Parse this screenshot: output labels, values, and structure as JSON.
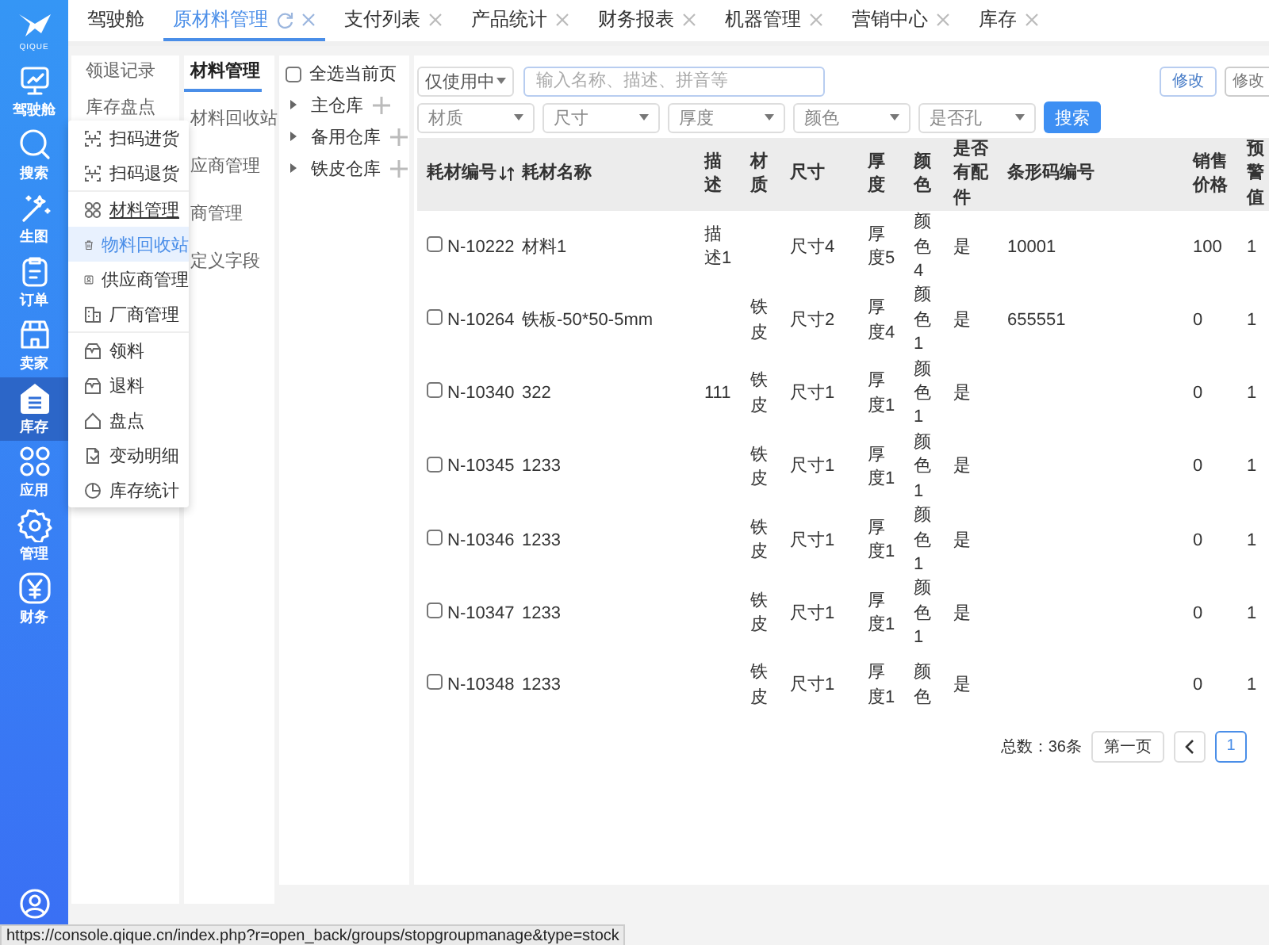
{
  "logo": {
    "text": "QIQUE"
  },
  "nav": [
    {
      "label": "驾驶舱",
      "selected": false
    },
    {
      "label": "搜索",
      "selected": false
    },
    {
      "label": "生图",
      "selected": false
    },
    {
      "label": "订单",
      "selected": false
    },
    {
      "label": "卖家",
      "selected": false
    },
    {
      "label": "库存",
      "selected": true
    },
    {
      "label": "应用",
      "selected": false
    },
    {
      "label": "管理",
      "selected": false
    },
    {
      "label": "财务",
      "selected": false
    }
  ],
  "tabs": [
    {
      "label": "驾驶舱",
      "selected": false,
      "closable": false,
      "refreshable": false
    },
    {
      "label": "原材料管理",
      "selected": true,
      "closable": true,
      "refreshable": true
    },
    {
      "label": "支付列表",
      "selected": false,
      "closable": true,
      "refreshable": false
    },
    {
      "label": "产品统计",
      "selected": false,
      "closable": true,
      "refreshable": false
    },
    {
      "label": "财务报表",
      "selected": false,
      "closable": true,
      "refreshable": false
    },
    {
      "label": "机器管理",
      "selected": false,
      "closable": true,
      "refreshable": false
    },
    {
      "label": "营销中心",
      "selected": false,
      "closable": true,
      "refreshable": false
    },
    {
      "label": "库存",
      "selected": false,
      "closable": true,
      "refreshable": false
    }
  ],
  "subnav_1": {
    "items": [
      {
        "label": "领退记录",
        "selected": false
      },
      {
        "label": "库存盘点",
        "selected": false
      }
    ]
  },
  "subnav_2": {
    "items": [
      {
        "label": "材料管理",
        "selected": true
      },
      {
        "label": "材料回收站",
        "selected": false
      },
      {
        "label": "应商管理",
        "selected": false
      },
      {
        "label": "商管理",
        "selected": false
      },
      {
        "label": "定义字段",
        "selected": false
      }
    ]
  },
  "dropdown": {
    "groups": [
      [
        {
          "label": "扫码进货",
          "selected": false,
          "hovered": false
        },
        {
          "label": "扫码退货",
          "selected": false,
          "hovered": false
        }
      ],
      [
        {
          "label": "材料管理",
          "selected": false,
          "hovered": true
        },
        {
          "label": "物料回收站",
          "selected": true,
          "hovered": false
        },
        {
          "label": "供应商管理",
          "selected": false,
          "hovered": false
        },
        {
          "label": "厂商管理",
          "selected": false,
          "hovered": false
        }
      ],
      [
        {
          "label": "领料",
          "selected": false,
          "hovered": false
        },
        {
          "label": "退料",
          "selected": false,
          "hovered": false
        },
        {
          "label": "盘点",
          "selected": false,
          "hovered": false
        },
        {
          "label": "变动明细",
          "selected": false,
          "hovered": false
        },
        {
          "label": "库存统计",
          "selected": false,
          "hovered": false
        }
      ]
    ]
  },
  "tree": {
    "select_all": {
      "label": "全选当前页",
      "checked": false
    },
    "nodes": [
      {
        "label": "主仓库",
        "expanded": false
      },
      {
        "label": "备用仓库",
        "expanded": false
      },
      {
        "label": "铁皮仓库",
        "expanded": false
      }
    ]
  },
  "filters": {
    "status_select": "仅使用中",
    "search": {
      "placeholder": "输入名称、描述、拼音等"
    },
    "selects": [
      "材质",
      "尺寸",
      "厚度",
      "颜色",
      "是否孔"
    ],
    "search_button": "搜索",
    "buttons": [
      "修改",
      "修改"
    ]
  },
  "table": {
    "columns": [
      "耗材编号",
      "耗材名称",
      "描述",
      "材质",
      "尺寸",
      "厚度",
      "颜色",
      "是否有配件",
      "条形码编号",
      "销售价格",
      "预警值"
    ],
    "rows": [
      {
        "checked": false,
        "cells": [
          "N-10222",
          "材料1",
          "描述1",
          "",
          "尺寸4",
          "厚度5",
          "颜色4",
          "是",
          "10001",
          "100",
          "1"
        ]
      },
      {
        "checked": false,
        "cells": [
          "N-10264",
          "铁板-50*50-5mm",
          "",
          "铁皮",
          "尺寸2",
          "厚度4",
          "颜色1",
          "是",
          "655551",
          "0",
          "1"
        ]
      },
      {
        "checked": false,
        "cells": [
          "N-10340",
          "322",
          "111",
          "铁皮",
          "尺寸1",
          "厚度1",
          "颜色1",
          "是",
          "",
          "0",
          "1"
        ]
      },
      {
        "checked": false,
        "cells": [
          "N-10345",
          "1233",
          "",
          "铁皮",
          "尺寸1",
          "厚度1",
          "颜色1",
          "是",
          "",
          "0",
          "1"
        ]
      },
      {
        "checked": false,
        "cells": [
          "N-10346",
          "1233",
          "",
          "铁皮",
          "尺寸1",
          "厚度1",
          "颜色1",
          "是",
          "",
          "0",
          "1"
        ]
      },
      {
        "checked": false,
        "cells": [
          "N-10347",
          "1233",
          "",
          "铁皮",
          "尺寸1",
          "厚度1",
          "颜色1",
          "是",
          "",
          "0",
          "1"
        ]
      },
      {
        "checked": false,
        "cells": [
          "N-10348",
          "1233",
          "",
          "铁皮",
          "尺寸1",
          "厚度1",
          "颜色",
          "是",
          "",
          "0",
          "1"
        ]
      }
    ]
  },
  "pagination": {
    "total": "总数：36条",
    "first": "第一页",
    "pages": [
      {
        "label": "1",
        "selected": true
      }
    ]
  },
  "status_bar": {
    "url": "https://console.qique.cn/index.php?r=open_back/groups/stopgroupmanage&type=stock"
  }
}
